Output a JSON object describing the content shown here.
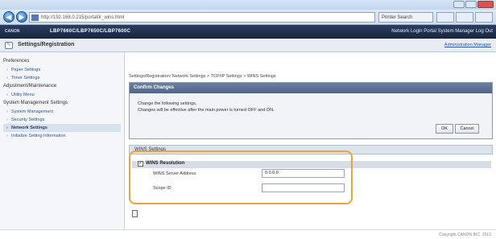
{
  "browser": {
    "address": "http://192.168.0.215/portal/ir_wins.html",
    "search": "Printer Search",
    "back_glyph": "◀",
    "forward_glyph": "▶"
  },
  "header": {
    "brand": "CANON",
    "device_name": "LBP7660C/LBP7650C/LBP7600C",
    "links": "Network Login  Portal  System Manager  Log Out"
  },
  "title_bar": {
    "title": "Settings/Registration",
    "right_link": "Administration Manager"
  },
  "sidebar": {
    "groups": [
      {
        "label": "Preferences",
        "items": [
          {
            "label": "Paper Settings"
          },
          {
            "label": "Timer Settings"
          }
        ]
      },
      {
        "label": "Adjustment/Maintenance",
        "items": [
          {
            "label": "Utility Menu"
          }
        ]
      },
      {
        "label": "System Management Settings",
        "items": [
          {
            "label": "System Management"
          },
          {
            "label": "Security Settings"
          },
          {
            "label": "Network Settings",
            "active": true
          },
          {
            "label": "Initialize Setting Information"
          }
        ]
      }
    ]
  },
  "main": {
    "intro": "Settings/Registration: Network Settings > TCP/IP Settings > WINS Settings",
    "confirm_panel": {
      "title": "Confirm Changes",
      "message1": "Change the following settings.",
      "message2": "Changes will be effective after the main power is turned OFF and ON.",
      "ok": "OK",
      "cancel": "Cancel"
    },
    "section_title": "WINS Settings",
    "wins": {
      "checked_glyph": "✓",
      "checkbox_label": "WINS Resolution",
      "server_label": "WINS Server Address",
      "server_value": "0.0.0.0",
      "scope_label": "Scope ID",
      "scope_value": ""
    }
  },
  "footer": {
    "copyright": "Copyright CANON INC. 2012"
  }
}
